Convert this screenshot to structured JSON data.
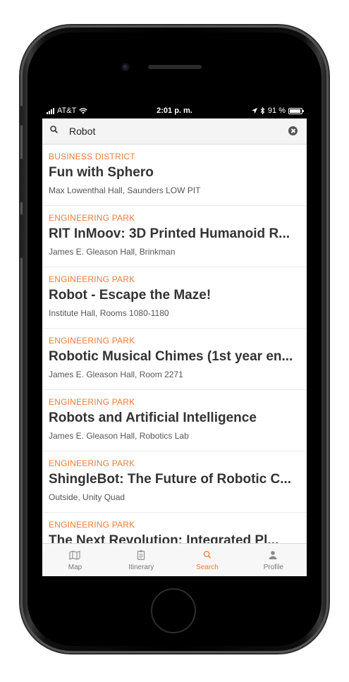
{
  "status_bar": {
    "carrier": "AT&T",
    "time": "2:01 p. m.",
    "battery": "91 %",
    "battery_level": 0.91
  },
  "search": {
    "query": "Robot",
    "placeholder": "Search"
  },
  "results": [
    {
      "category": "BUSINESS DISTRICT",
      "title": "Fun with Sphero",
      "location": "Max Lowenthal Hall, Saunders LOW PIT"
    },
    {
      "category": "ENGINEERING PARK",
      "title": "RIT InMoov: 3D Printed Humanoid R...",
      "location": "James E. Gleason Hall, Brinkman"
    },
    {
      "category": "ENGINEERING PARK",
      "title": "Robot - Escape the Maze!",
      "location": "Institute Hall, Rooms 1080-1180"
    },
    {
      "category": "ENGINEERING PARK",
      "title": "Robotic Musical Chimes (1st year en...",
      "location": "James E. Gleason Hall, Room 2271"
    },
    {
      "category": "ENGINEERING PARK",
      "title": "Robots and Artificial Intelligence",
      "location": "James E. Gleason Hall, Robotics Lab"
    },
    {
      "category": "ENGINEERING PARK",
      "title": "ShingleBot: The Future of Robotic C...",
      "location": "Outside, Unity Quad"
    },
    {
      "category": "ENGINEERING PARK",
      "title": "The Next Revolution: Integrated Pl...",
      "location": ""
    }
  ],
  "tabs": [
    {
      "label": "Map",
      "icon": "map-icon",
      "active": false
    },
    {
      "label": "Itinerary",
      "icon": "clipboard-icon",
      "active": false
    },
    {
      "label": "Search",
      "icon": "search-icon",
      "active": true
    },
    {
      "label": "Profile",
      "icon": "person-icon",
      "active": false
    }
  ],
  "colors": {
    "accent": "#f07d3a",
    "title": "#333333",
    "subtitle": "#555555"
  }
}
